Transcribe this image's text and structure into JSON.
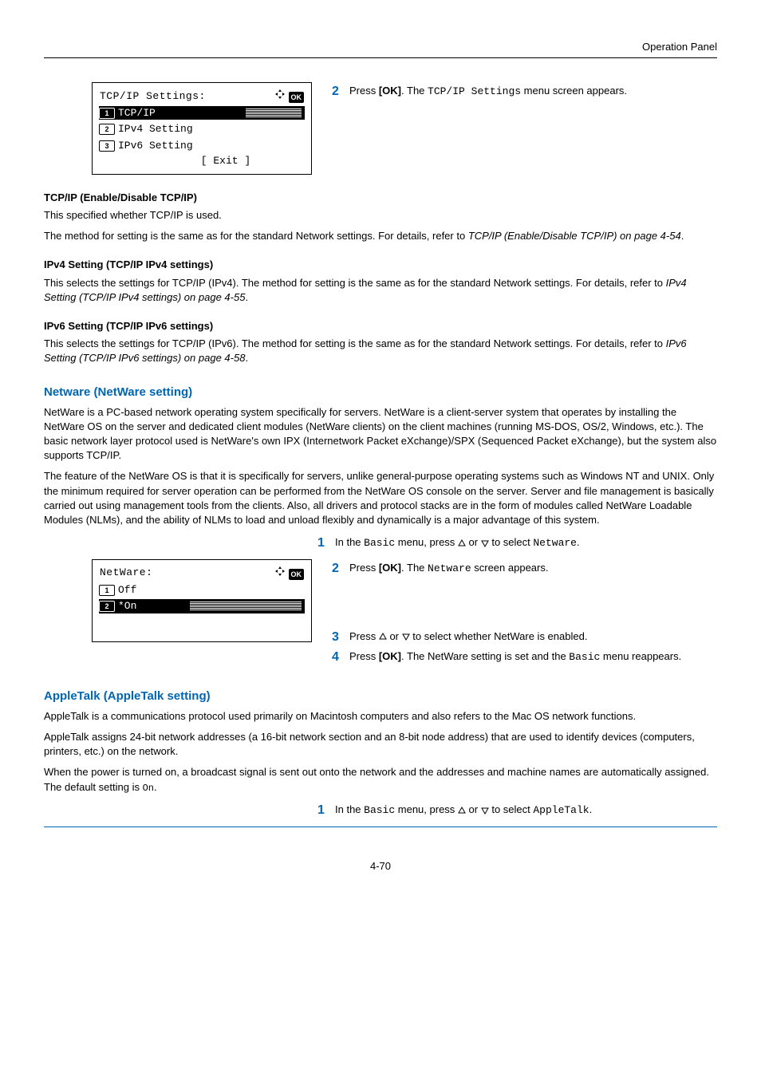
{
  "header": {
    "section": "Operation Panel"
  },
  "lcd1": {
    "title": "TCP/IP Settings:",
    "items": [
      {
        "num": "1",
        "label": "TCP/IP",
        "selected": true,
        "hatch": true
      },
      {
        "num": "2",
        "label": "IPv4 Setting",
        "selected": false
      },
      {
        "num": "3",
        "label": "IPv6 Setting",
        "selected": false
      }
    ],
    "exit": "[  Exit  ]"
  },
  "step2a": {
    "num": "2",
    "pre": "Press ",
    "bold": "[OK]",
    "mid": ". The ",
    "mono": "TCP/IP Settings",
    "post": " menu screen appears."
  },
  "sec_tcpip": {
    "heading": "TCP/IP (Enable/Disable TCP/IP)",
    "p1": "This specified whether TCP/IP is used.",
    "p2a": "The method for setting is the same as for the standard Network settings. For details, refer to ",
    "p2b": "TCP/IP (Enable/Disable TCP/IP) on page 4-54",
    "p2c": "."
  },
  "sec_ipv4": {
    "heading": "IPv4 Setting (TCP/IP IPv4 settings)",
    "p1a": "This selects the settings for TCP/IP (IPv4). The method for setting is the same as for the standard Network settings. For details, refer to ",
    "p1b": "IPv4 Setting (TCP/IP IPv4 settings) on page 4-55",
    "p1c": "."
  },
  "sec_ipv6": {
    "heading": "IPv6 Setting (TCP/IP IPv6 settings)",
    "p1a": "This selects the settings for TCP/IP (IPv6). The method for setting is the same as for the standard Network settings. For details, refer to ",
    "p1b": "IPv6 Setting (TCP/IP IPv6 settings) on page 4-58",
    "p1c": "."
  },
  "netware": {
    "heading": "Netware (NetWare setting)",
    "p1": "NetWare is a PC-based network operating system specifically for servers. NetWare is a client-server system that operates by installing the NetWare OS on the server and dedicated client modules (NetWare clients) on the client machines (running MS-DOS, OS/2, Windows, etc.). The basic network layer protocol used is NetWare's own IPX (Internetwork Packet eXchange)/SPX (Sequenced Packet eXchange), but the system also supports TCP/IP.",
    "p2": "The feature of the NetWare OS is that it is specifically for servers, unlike general-purpose operating systems such as Windows NT and UNIX. Only the minimum required for server operation can be performed from the NetWare OS console on the server. Server and file management is basically carried out using management tools from the clients. Also, all drivers and protocol stacks are in the form of modules called NetWare Loadable Modules (NLMs), and the ability of NLMs to load and unload flexibly and dynamically is a major advantage of this system.",
    "step1": {
      "num": "1",
      "pre": "In the ",
      "mono1": "Basic",
      "mid": " menu, press ",
      "or": " or ",
      "post": " to select ",
      "mono2": "Netware",
      "end": "."
    },
    "step2": {
      "num": "2",
      "pre": "Press ",
      "bold": "[OK]",
      "mid": ". The ",
      "mono": "Netware",
      "post": " screen appears."
    },
    "step3": {
      "num": "3",
      "pre": "Press ",
      "or": " or ",
      "post": " to select whether NetWare is enabled."
    },
    "step4": {
      "num": "4",
      "pre": "Press ",
      "bold": "[OK]",
      "mid": ". The NetWare setting is set and the ",
      "mono": "Basic",
      "post": " menu reappears."
    }
  },
  "lcd2": {
    "title": "NetWare:",
    "items": [
      {
        "num": "1",
        "label": "Off",
        "selected": false
      },
      {
        "num": "2",
        "label": "*On",
        "selected": true,
        "hatch": true
      }
    ]
  },
  "appletalk": {
    "heading": "AppleTalk (AppleTalk setting)",
    "p1": "AppleTalk is a communications protocol used primarily on Macintosh computers and also refers to the Mac OS network functions.",
    "p2": "AppleTalk assigns 24-bit network addresses (a 16-bit network section and an 8-bit node address) that are used to identify devices (computers, printers, etc.) on the network.",
    "p3a": "When the power is turned on, a broadcast signal is sent out onto the network and the addresses and machine names are automatically assigned. The default setting is ",
    "p3mono": "On",
    "p3b": ".",
    "step1": {
      "num": "1",
      "pre": "In the ",
      "mono1": "Basic",
      "mid": " menu, press ",
      "or": " or ",
      "post": " to select ",
      "mono2": "AppleTalk",
      "end": "."
    }
  },
  "footer": {
    "page": "4-70"
  }
}
